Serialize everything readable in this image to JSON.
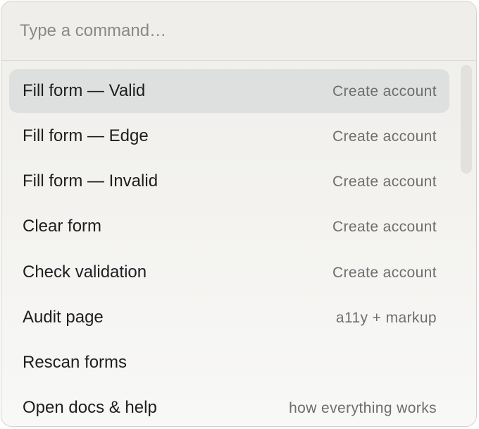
{
  "search": {
    "placeholder": "Type a command…",
    "value": ""
  },
  "commands": [
    {
      "label": "Fill form — Valid",
      "hint": "Create account",
      "active": true
    },
    {
      "label": "Fill form — Edge",
      "hint": "Create account",
      "active": false
    },
    {
      "label": "Fill form — Invalid",
      "hint": "Create account",
      "active": false
    },
    {
      "label": "Clear form",
      "hint": "Create account",
      "active": false
    },
    {
      "label": "Check validation",
      "hint": "Create account",
      "active": false
    },
    {
      "label": "Audit page",
      "hint": "a11y + markup",
      "active": false
    },
    {
      "label": "Rescan forms",
      "hint": "",
      "active": false
    },
    {
      "label": "Open docs & help",
      "hint": "how everything works",
      "active": false
    }
  ],
  "colors": {
    "highlight": "#dedfdf",
    "text": "#1e1e1e",
    "hint": "#6e6e6e"
  }
}
